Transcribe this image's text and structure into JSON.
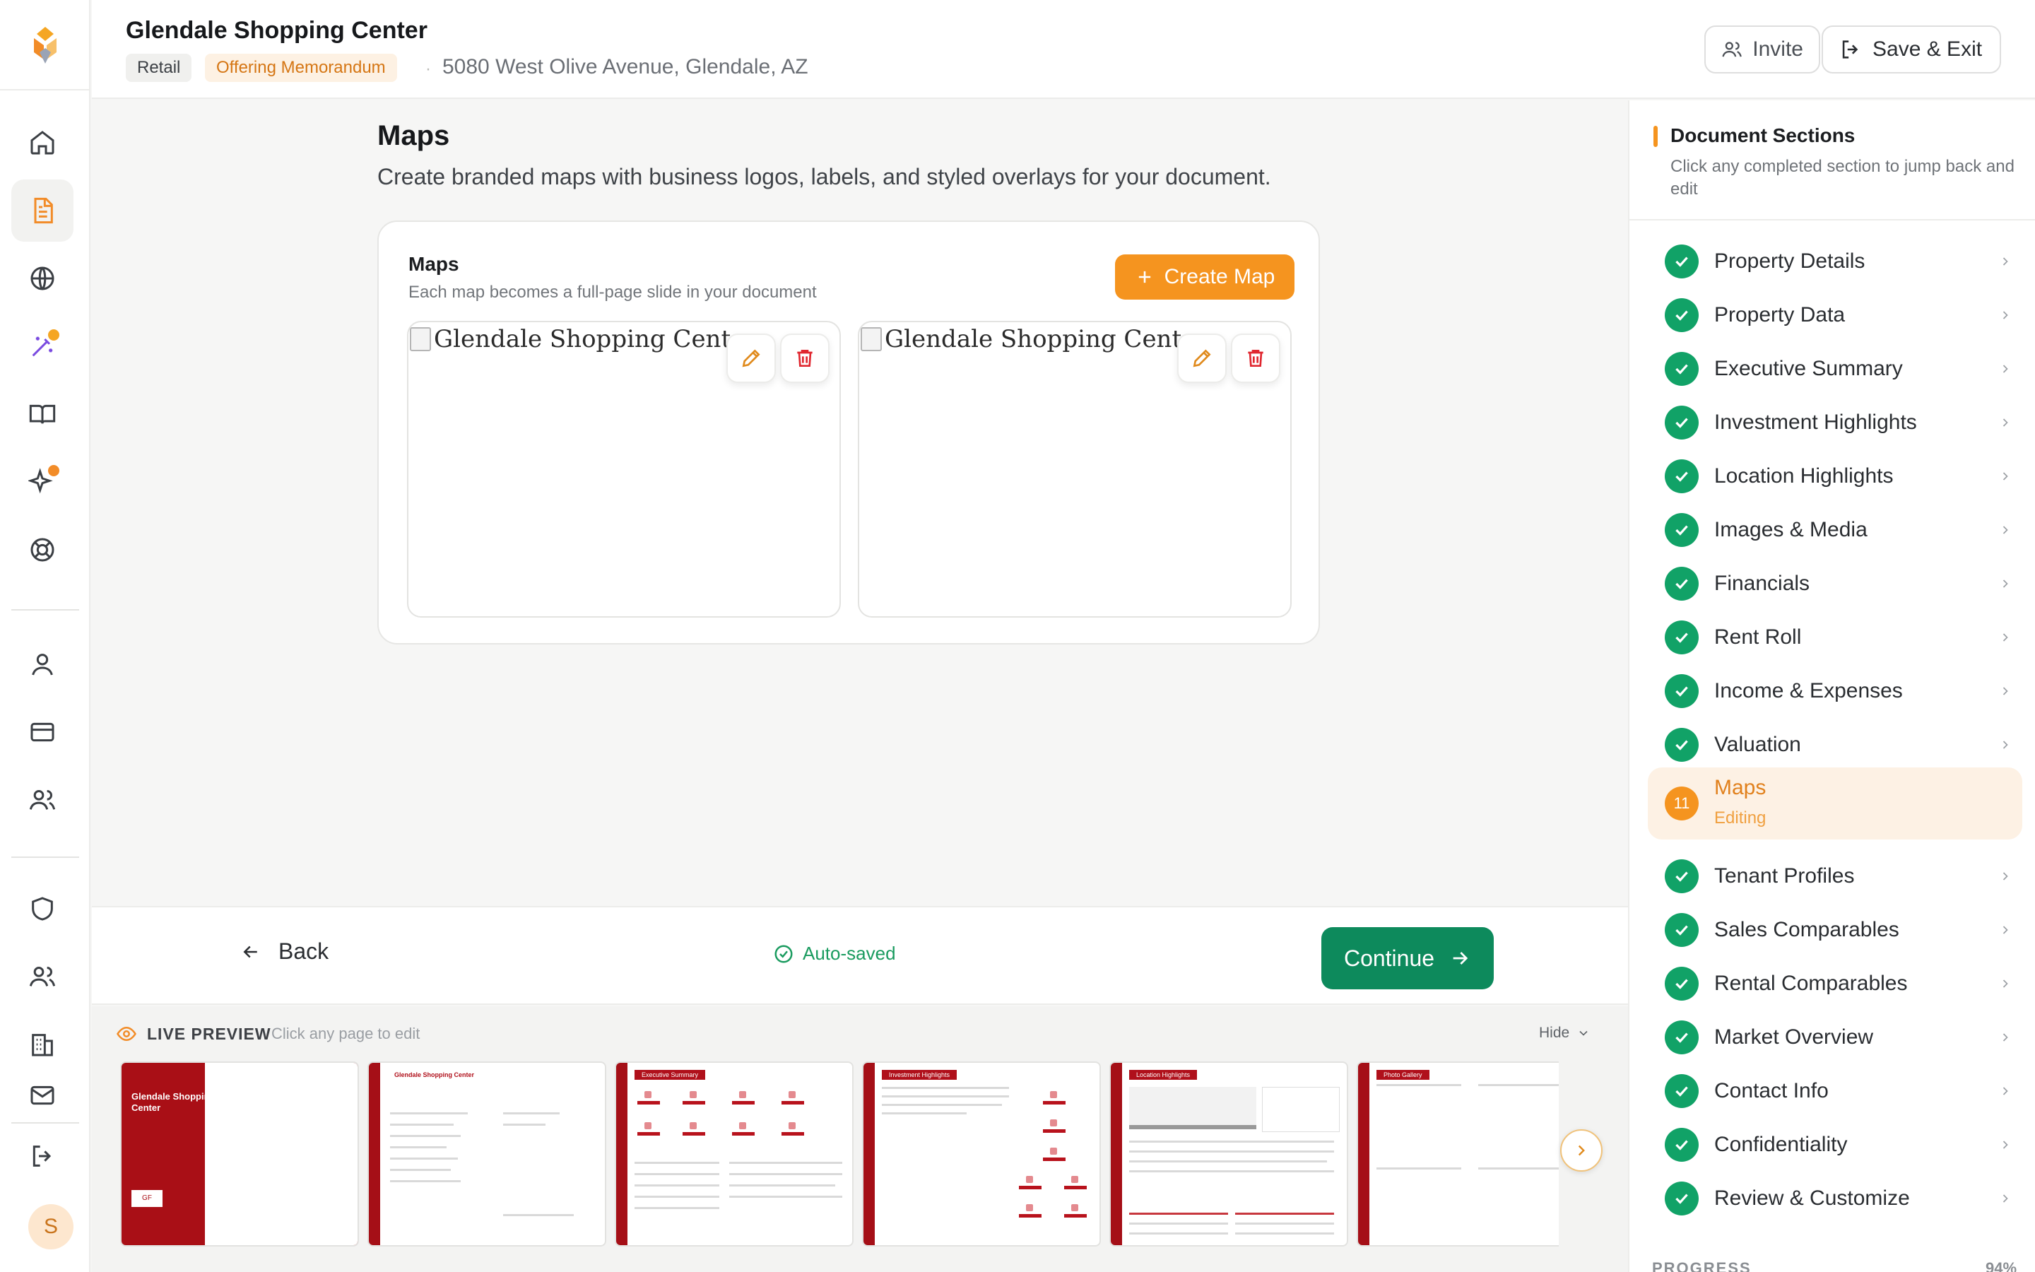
{
  "header": {
    "title": "Glendale Shopping Center",
    "tag_type": "Retail",
    "tag_doc": "Offering Memorandum",
    "address": "5080 West Olive Avenue, Glendale, AZ",
    "invite_label": "Invite",
    "save_exit_label": "Save & Exit"
  },
  "rail": {
    "avatar_initial": "S",
    "icons": [
      "home-icon",
      "document-icon",
      "globe-icon",
      "magic-wand-icon",
      "book-icon",
      "sparkles-icon",
      "lifebuoy-icon",
      "user-icon",
      "credit-card-icon",
      "users-icon",
      "shield-icon",
      "team-icon",
      "building-icon",
      "mail-icon",
      "logout-icon"
    ]
  },
  "main": {
    "title": "Maps",
    "subtitle": "Create branded maps with business logos, labels, and styled overlays for your document.",
    "card": {
      "title": "Maps",
      "subtitle": "Each map becomes a full-page slide in your document",
      "create_label": "Create Map",
      "maps": [
        {
          "alt": "Glendale Shopping Center"
        },
        {
          "alt": "Glendale Shopping Center"
        }
      ]
    }
  },
  "footer": {
    "back_label": "Back",
    "autosave_label": "Auto-saved",
    "continue_label": "Continue"
  },
  "preview": {
    "title": "LIVE PREVIEW",
    "hint": "Click any page to edit",
    "hide_label": "Hide",
    "pages": [
      {
        "chip": "",
        "name": "Glendale Shopping Center"
      },
      {
        "chip": "Glendale Shopping Center"
      },
      {
        "chip": "Executive Summary"
      },
      {
        "chip": "Investment Highlights"
      },
      {
        "chip": "Location Highlights"
      },
      {
        "chip": "Photo Gallery"
      }
    ],
    "cover_logo": "GF"
  },
  "sidebar": {
    "title": "Document Sections",
    "subtitle": "Click any completed section to jump back and edit",
    "sections": [
      {
        "label": "Property Details",
        "status": "done"
      },
      {
        "label": "Property Data",
        "status": "done"
      },
      {
        "label": "Executive Summary",
        "status": "done"
      },
      {
        "label": "Investment Highlights",
        "status": "done"
      },
      {
        "label": "Location Highlights",
        "status": "done"
      },
      {
        "label": "Images & Media",
        "status": "done"
      },
      {
        "label": "Financials",
        "status": "done"
      },
      {
        "label": "Rent Roll",
        "status": "done"
      },
      {
        "label": "Income & Expenses",
        "status": "done"
      },
      {
        "label": "Valuation",
        "status": "done"
      },
      {
        "label": "Maps",
        "status": "active",
        "number": "11",
        "state": "Editing"
      },
      {
        "label": "Tenant Profiles",
        "status": "done"
      },
      {
        "label": "Sales Comparables",
        "status": "done"
      },
      {
        "label": "Rental Comparables",
        "status": "done"
      },
      {
        "label": "Market Overview",
        "status": "done"
      },
      {
        "label": "Contact Info",
        "status": "done"
      },
      {
        "label": "Confidentiality",
        "status": "done"
      },
      {
        "label": "Review & Customize",
        "status": "done"
      }
    ],
    "progress_label": "PROGRESS",
    "progress_pct": "94%"
  },
  "colors": {
    "accent": "#f5941f",
    "success": "#11a267",
    "continue": "#0d8a5c",
    "preview_red": "#a90f16"
  }
}
